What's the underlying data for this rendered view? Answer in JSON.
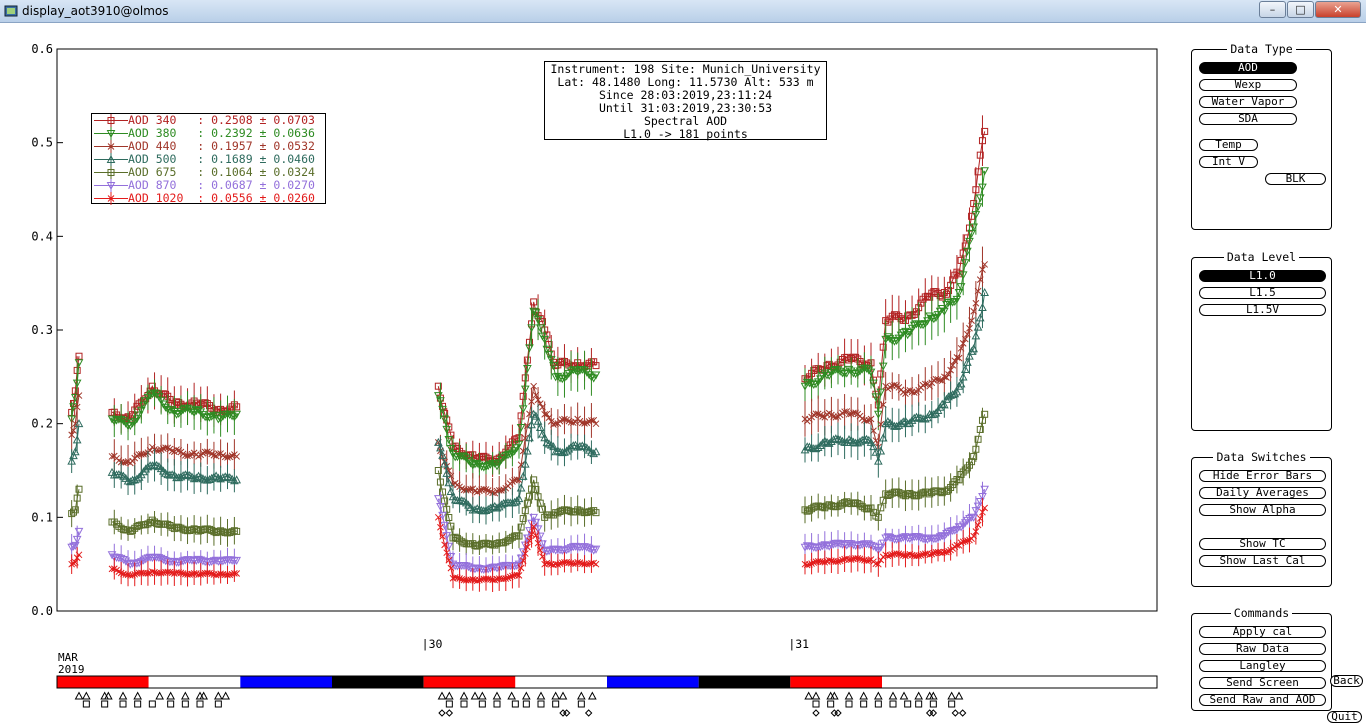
{
  "window": {
    "title": "display_aot3910@olmos",
    "min": "–",
    "max": "□",
    "close": "✕"
  },
  "info": [
    "Instrument: 198 Site: Munich_University",
    "Lat: 48.1480 Long: 11.5730 Alt: 533 m",
    "Since 28:03:2019,23:11:24",
    "Until 31:03:2019,23:30:53",
    "Spectral AOD",
    "L1.0 -> 181 points"
  ],
  "legend": [
    {
      "label": "AOD 340   : 0.2508 ± 0.0703",
      "color": "#b22222",
      "marker": "square"
    },
    {
      "label": "AOD 380   : 0.2392 ± 0.0636",
      "color": "#2e8b22",
      "marker": "tri-down"
    },
    {
      "label": "AOD 440   : 0.1957 ± 0.0532",
      "color": "#a0362a",
      "marker": "x"
    },
    {
      "label": "AOD 500   : 0.1689 ± 0.0460",
      "color": "#2e6b5e",
      "marker": "tri-up"
    },
    {
      "label": "AOD 675   : 0.1064 ± 0.0324",
      "color": "#5a6e2a",
      "marker": "square"
    },
    {
      "label": "AOD 870   : 0.0687 ± 0.0270",
      "color": "#9370db",
      "marker": "tri-down"
    },
    {
      "label": "AOD 1020  : 0.0556 ± 0.0260",
      "color": "#e31b1b",
      "marker": "x"
    }
  ],
  "data_type": {
    "title": "Data Type",
    "buttons": [
      "AOD",
      "Wexp",
      "Water Vapor",
      "SDA",
      "Temp",
      "Int V",
      "BLK"
    ],
    "selected": "AOD"
  },
  "data_level": {
    "title": "Data Level",
    "buttons": [
      "L1.0",
      "L1.5",
      "L1.5V"
    ],
    "selected": "L1.0"
  },
  "data_switches": {
    "title": "Data Switches",
    "buttons": [
      "Hide Error Bars",
      "Daily Averages",
      "Show Alpha",
      "Show TC",
      "Show Last Cal"
    ]
  },
  "commands": {
    "title": "Commands",
    "buttons": [
      "Apply cal",
      "Raw Data",
      "Langley",
      "Send Screen",
      "Send Raw and AOD"
    ]
  },
  "extra_buttons": {
    "back": "Back",
    "quit": "Quit"
  },
  "chart_data": {
    "type": "scatter",
    "title": "Spectral AOD",
    "xlabel": "",
    "ylabel": "",
    "ylim": [
      0.0,
      0.6
    ],
    "y_ticks": [
      "0.0",
      "0.1",
      "0.2",
      "0.3",
      "0.4",
      "0.5",
      "0.6"
    ],
    "x_start_label": [
      "MAR",
      "2019"
    ],
    "x_ticks": [
      {
        "day": 30,
        "label": "|30"
      },
      {
        "day": 31,
        "label": "|31"
      }
    ],
    "xlim_days": [
      29.0,
      32.0
    ],
    "segments": [
      {
        "start": 29.04,
        "end": 29.06
      },
      {
        "start": 29.15,
        "end": 29.49
      },
      {
        "start": 30.04,
        "end": 30.47
      },
      {
        "start": 31.04,
        "end": 31.53
      }
    ],
    "series": [
      {
        "name": "AOD 340",
        "points": [
          [
            29.04,
            0.212
          ],
          [
            29.05,
            0.235
          ],
          [
            29.06,
            0.272
          ],
          [
            29.15,
            0.212
          ],
          [
            29.2,
            0.205
          ],
          [
            29.26,
            0.24
          ],
          [
            29.32,
            0.22
          ],
          [
            29.38,
            0.222
          ],
          [
            29.44,
            0.215
          ],
          [
            29.49,
            0.218
          ],
          [
            30.04,
            0.24
          ],
          [
            30.08,
            0.175
          ],
          [
            30.14,
            0.163
          ],
          [
            30.2,
            0.162
          ],
          [
            30.26,
            0.185
          ],
          [
            30.3,
            0.33
          ],
          [
            30.33,
            0.3
          ],
          [
            30.36,
            0.262
          ],
          [
            30.42,
            0.265
          ],
          [
            30.47,
            0.262
          ],
          [
            31.04,
            0.248
          ],
          [
            31.1,
            0.262
          ],
          [
            31.16,
            0.268
          ],
          [
            31.22,
            0.265
          ],
          [
            31.24,
            0.22
          ],
          [
            31.26,
            0.31
          ],
          [
            31.32,
            0.315
          ],
          [
            31.38,
            0.335
          ],
          [
            31.42,
            0.34
          ],
          [
            31.46,
            0.36
          ],
          [
            31.5,
            0.435
          ],
          [
            31.53,
            0.512
          ]
        ]
      },
      {
        "name": "AOD 380",
        "points": [
          [
            29.04,
            0.205
          ],
          [
            29.05,
            0.228
          ],
          [
            29.06,
            0.265
          ],
          [
            29.15,
            0.205
          ],
          [
            29.2,
            0.198
          ],
          [
            29.26,
            0.232
          ],
          [
            29.32,
            0.213
          ],
          [
            29.38,
            0.214
          ],
          [
            29.44,
            0.205
          ],
          [
            29.49,
            0.21
          ],
          [
            30.04,
            0.23
          ],
          [
            30.08,
            0.168
          ],
          [
            30.14,
            0.157
          ],
          [
            30.2,
            0.155
          ],
          [
            30.26,
            0.178
          ],
          [
            30.3,
            0.32
          ],
          [
            30.33,
            0.29
          ],
          [
            30.36,
            0.25
          ],
          [
            30.42,
            0.255
          ],
          [
            30.47,
            0.252
          ],
          [
            31.04,
            0.24
          ],
          [
            31.1,
            0.252
          ],
          [
            31.16,
            0.258
          ],
          [
            31.22,
            0.255
          ],
          [
            31.24,
            0.21
          ],
          [
            31.26,
            0.29
          ],
          [
            31.32,
            0.295
          ],
          [
            31.38,
            0.315
          ],
          [
            31.42,
            0.32
          ],
          [
            31.46,
            0.34
          ],
          [
            31.5,
            0.41
          ],
          [
            31.53,
            0.47
          ]
        ]
      },
      {
        "name": "AOD 440",
        "points": [
          [
            29.04,
            0.188
          ],
          [
            29.05,
            0.2
          ],
          [
            29.06,
            0.23
          ],
          [
            29.15,
            0.165
          ],
          [
            29.2,
            0.158
          ],
          [
            29.26,
            0.175
          ],
          [
            29.32,
            0.17
          ],
          [
            29.38,
            0.167
          ],
          [
            29.44,
            0.168
          ],
          [
            29.49,
            0.165
          ],
          [
            30.04,
            0.18
          ],
          [
            30.08,
            0.135
          ],
          [
            30.14,
            0.128
          ],
          [
            30.2,
            0.128
          ],
          [
            30.26,
            0.14
          ],
          [
            30.3,
            0.24
          ],
          [
            30.33,
            0.21
          ],
          [
            30.36,
            0.2
          ],
          [
            30.42,
            0.205
          ],
          [
            30.47,
            0.2
          ],
          [
            31.04,
            0.205
          ],
          [
            31.1,
            0.21
          ],
          [
            31.16,
            0.21
          ],
          [
            31.22,
            0.205
          ],
          [
            31.24,
            0.175
          ],
          [
            31.26,
            0.24
          ],
          [
            31.32,
            0.235
          ],
          [
            31.38,
            0.24
          ],
          [
            31.42,
            0.25
          ],
          [
            31.46,
            0.27
          ],
          [
            31.5,
            0.32
          ],
          [
            31.53,
            0.37
          ]
        ]
      },
      {
        "name": "AOD 500",
        "points": [
          [
            29.04,
            0.16
          ],
          [
            29.05,
            0.17
          ],
          [
            29.06,
            0.2
          ],
          [
            29.15,
            0.148
          ],
          [
            29.2,
            0.138
          ],
          [
            29.26,
            0.155
          ],
          [
            29.32,
            0.145
          ],
          [
            29.38,
            0.142
          ],
          [
            29.44,
            0.142
          ],
          [
            29.49,
            0.14
          ],
          [
            30.04,
            0.18
          ],
          [
            30.08,
            0.122
          ],
          [
            30.14,
            0.108
          ],
          [
            30.2,
            0.11
          ],
          [
            30.26,
            0.12
          ],
          [
            30.3,
            0.21
          ],
          [
            30.33,
            0.185
          ],
          [
            30.36,
            0.17
          ],
          [
            30.42,
            0.175
          ],
          [
            30.47,
            0.17
          ],
          [
            31.04,
            0.172
          ],
          [
            31.1,
            0.18
          ],
          [
            31.16,
            0.183
          ],
          [
            31.22,
            0.18
          ],
          [
            31.24,
            0.16
          ],
          [
            31.26,
            0.2
          ],
          [
            31.32,
            0.2
          ],
          [
            31.38,
            0.21
          ],
          [
            31.42,
            0.22
          ],
          [
            31.46,
            0.24
          ],
          [
            31.5,
            0.28
          ],
          [
            31.53,
            0.34
          ]
        ]
      },
      {
        "name": "AOD 675",
        "points": [
          [
            29.04,
            0.104
          ],
          [
            29.05,
            0.108
          ],
          [
            29.06,
            0.13
          ],
          [
            29.15,
            0.095
          ],
          [
            29.2,
            0.085
          ],
          [
            29.26,
            0.097
          ],
          [
            29.32,
            0.088
          ],
          [
            29.38,
            0.087
          ],
          [
            29.44,
            0.085
          ],
          [
            29.49,
            0.085
          ],
          [
            30.04,
            0.15
          ],
          [
            30.08,
            0.078
          ],
          [
            30.14,
            0.07
          ],
          [
            30.2,
            0.072
          ],
          [
            30.26,
            0.08
          ],
          [
            30.3,
            0.14
          ],
          [
            30.33,
            0.1
          ],
          [
            30.36,
            0.105
          ],
          [
            30.42,
            0.108
          ],
          [
            30.47,
            0.105
          ],
          [
            31.04,
            0.108
          ],
          [
            31.1,
            0.112
          ],
          [
            31.16,
            0.115
          ],
          [
            31.22,
            0.11
          ],
          [
            31.24,
            0.1
          ],
          [
            31.26,
            0.125
          ],
          [
            31.32,
            0.125
          ],
          [
            31.38,
            0.125
          ],
          [
            31.42,
            0.128
          ],
          [
            31.46,
            0.14
          ],
          [
            31.5,
            0.165
          ],
          [
            31.53,
            0.21
          ]
        ]
      },
      {
        "name": "AOD 870",
        "points": [
          [
            29.04,
            0.068
          ],
          [
            29.05,
            0.07
          ],
          [
            29.06,
            0.085
          ],
          [
            29.15,
            0.06
          ],
          [
            29.2,
            0.05
          ],
          [
            29.26,
            0.057
          ],
          [
            29.32,
            0.053
          ],
          [
            29.38,
            0.054
          ],
          [
            29.44,
            0.053
          ],
          [
            29.49,
            0.054
          ],
          [
            30.04,
            0.12
          ],
          [
            30.08,
            0.05
          ],
          [
            30.14,
            0.045
          ],
          [
            30.2,
            0.046
          ],
          [
            30.26,
            0.05
          ],
          [
            30.3,
            0.1
          ],
          [
            30.33,
            0.065
          ],
          [
            30.36,
            0.065
          ],
          [
            30.42,
            0.068
          ],
          [
            30.47,
            0.066
          ],
          [
            31.04,
            0.068
          ],
          [
            31.1,
            0.07
          ],
          [
            31.16,
            0.072
          ],
          [
            31.22,
            0.07
          ],
          [
            31.24,
            0.065
          ],
          [
            31.26,
            0.078
          ],
          [
            31.32,
            0.078
          ],
          [
            31.38,
            0.078
          ],
          [
            31.42,
            0.08
          ],
          [
            31.46,
            0.09
          ],
          [
            31.5,
            0.1
          ],
          [
            31.53,
            0.13
          ]
        ]
      },
      {
        "name": "AOD 1020",
        "points": [
          [
            29.04,
            0.05
          ],
          [
            29.05,
            0.052
          ],
          [
            29.06,
            0.06
          ],
          [
            29.15,
            0.045
          ],
          [
            29.2,
            0.038
          ],
          [
            29.26,
            0.042
          ],
          [
            29.32,
            0.04
          ],
          [
            29.38,
            0.04
          ],
          [
            29.44,
            0.039
          ],
          [
            29.49,
            0.04
          ],
          [
            30.04,
            0.1
          ],
          [
            30.08,
            0.035
          ],
          [
            30.14,
            0.033
          ],
          [
            30.2,
            0.034
          ],
          [
            30.26,
            0.038
          ],
          [
            30.3,
            0.09
          ],
          [
            30.33,
            0.05
          ],
          [
            30.36,
            0.05
          ],
          [
            30.42,
            0.052
          ],
          [
            30.47,
            0.05
          ],
          [
            31.04,
            0.05
          ],
          [
            31.1,
            0.053
          ],
          [
            31.16,
            0.055
          ],
          [
            31.22,
            0.055
          ],
          [
            31.24,
            0.05
          ],
          [
            31.26,
            0.06
          ],
          [
            31.32,
            0.06
          ],
          [
            31.38,
            0.06
          ],
          [
            31.42,
            0.063
          ],
          [
            31.46,
            0.07
          ],
          [
            31.5,
            0.08
          ],
          [
            31.53,
            0.11
          ]
        ]
      }
    ],
    "daybar": [
      {
        "start": 29.0,
        "end": 29.25,
        "color": "#ff0000"
      },
      {
        "start": 29.25,
        "end": 29.5,
        "color": "#ffffff"
      },
      {
        "start": 29.5,
        "end": 29.75,
        "color": "#0000ff"
      },
      {
        "start": 29.75,
        "end": 30.0,
        "color": "#000000"
      },
      {
        "start": 30.0,
        "end": 30.25,
        "color": "#ff0000"
      },
      {
        "start": 30.25,
        "end": 30.5,
        "color": "#ffffff"
      },
      {
        "start": 30.5,
        "end": 30.75,
        "color": "#0000ff"
      },
      {
        "start": 30.75,
        "end": 31.0,
        "color": "#000000"
      },
      {
        "start": 31.0,
        "end": 31.25,
        "color": "#ff0000"
      },
      {
        "start": 31.25,
        "end": 31.5,
        "color": "#ffffff"
      }
    ],
    "daybar_markers": {
      "triangles": [
        29.06,
        29.08,
        29.13,
        29.14,
        29.18,
        29.22,
        29.28,
        29.31,
        29.35,
        29.39,
        29.4,
        29.44,
        29.46,
        30.05,
        30.07,
        30.11,
        30.14,
        30.16,
        30.2,
        30.24,
        30.28,
        30.32,
        30.36,
        30.38,
        30.43,
        30.46,
        31.05,
        31.07,
        31.11,
        31.12,
        31.16,
        31.2,
        31.24,
        31.28,
        31.31,
        31.35,
        31.38,
        31.39,
        31.44,
        31.46
      ],
      "squares": [
        29.08,
        29.13,
        29.18,
        29.22,
        29.26,
        29.31,
        29.35,
        29.39,
        29.44,
        30.07,
        30.11,
        30.16,
        30.2,
        30.25,
        30.28,
        30.32,
        30.36,
        30.43,
        31.07,
        31.11,
        31.16,
        31.2,
        31.24,
        31.28,
        31.32,
        31.35,
        31.39,
        31.44
      ],
      "diamonds": [
        30.05,
        30.07,
        30.38,
        30.39,
        30.45,
        31.07,
        31.12,
        31.13,
        31.38,
        31.39,
        31.45,
        31.47
      ]
    }
  }
}
